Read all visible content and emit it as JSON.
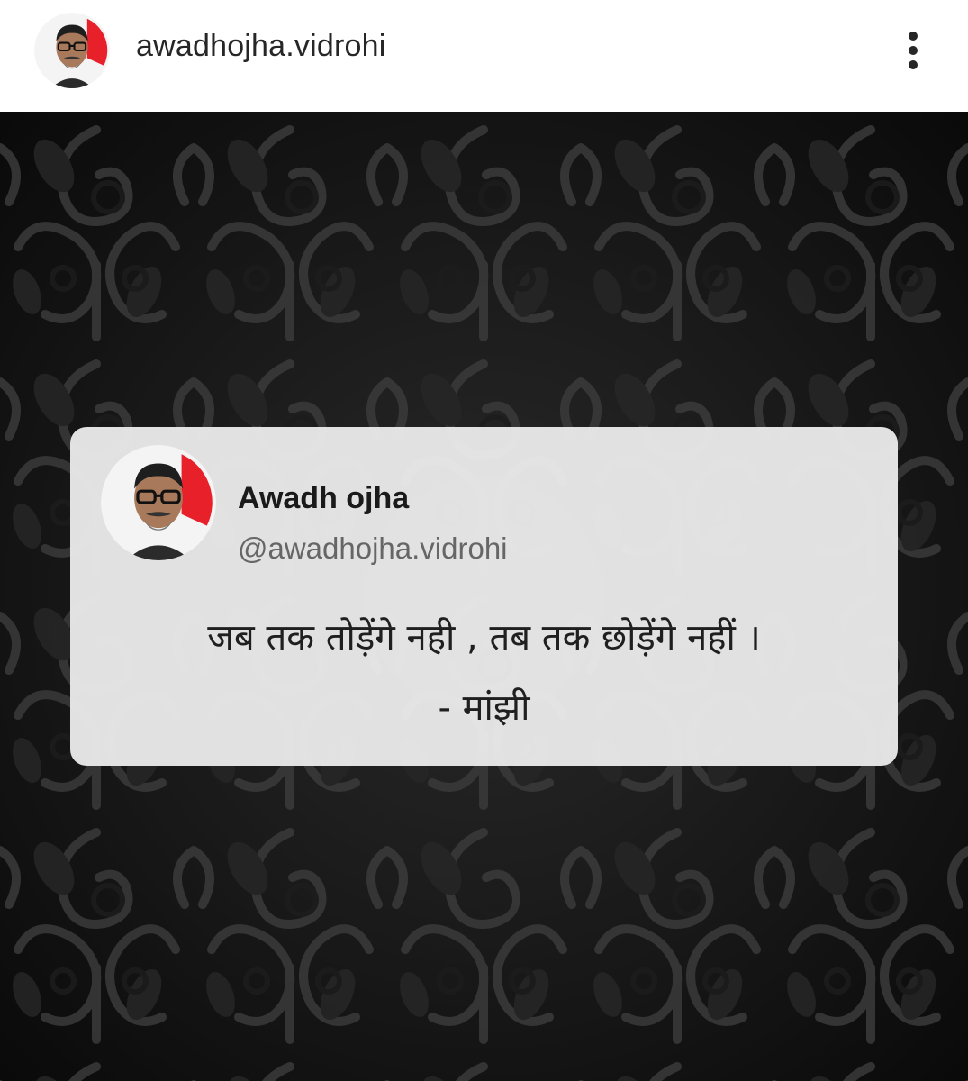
{
  "header": {
    "username": "awadhojha.vidrohi",
    "avatar_icon": "profile-avatar",
    "more_icon": "more-vertical-icon"
  },
  "post": {
    "background": "black damask floral pattern",
    "card": {
      "name": "Awadh ojha",
      "handle": "@awadhojha.vidrohi",
      "quote": "जब तक तोड़ेंगे नही , तब तक छोड़ेंगे नहीं ।",
      "attribution": "- मांझी"
    }
  },
  "colors": {
    "header_bg": "#ffffff",
    "text_primary": "#262626",
    "card_bg": "#ececec",
    "handle_text": "#666666",
    "avatar_ring": "#e8202a"
  }
}
